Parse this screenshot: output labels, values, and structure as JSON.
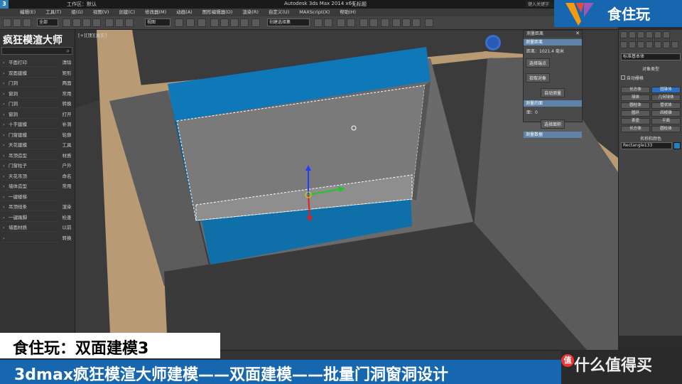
{
  "window": {
    "title": "Autodesk 3ds Max 2014 x64",
    "workspace": "工作区：默认",
    "status": "无标题",
    "search_placeholder": "键入关键字"
  },
  "menubar": {
    "items": [
      "编辑(E)",
      "工具(T)",
      "组(G)",
      "视图(V)",
      "创建(C)",
      "修改器(M)",
      "动画(A)",
      "图形编辑器(D)",
      "渲染(R)",
      "自定义(U)",
      "MAXScript(X)",
      "帮助(H)"
    ]
  },
  "toolbar": {
    "selection_filter": "全部",
    "view_mode": "视图",
    "named_selection": "创建选择集"
  },
  "left_panel": {
    "title": "疯狂模渲大师",
    "rows": [
      {
        "label": "平面打印",
        "side": "清除"
      },
      {
        "label": "双面建模",
        "side": "矩形"
      },
      {
        "label": "门洞",
        "side": "两面"
      },
      {
        "label": "窗洞",
        "side": "常用"
      },
      {
        "label": "门洞",
        "side": "转换"
      },
      {
        "label": "窗洞",
        "side": "打开"
      },
      {
        "label": "十字建模",
        "side": "补洞"
      },
      {
        "label": "门窗建模",
        "side": "轮廓"
      },
      {
        "label": "天花建模",
        "side": "工具"
      },
      {
        "label": "吊顶造型",
        "side": "材质"
      },
      {
        "label": "门窗柱子",
        "side": "户外"
      },
      {
        "label": "天花吊顶",
        "side": "命名"
      },
      {
        "label": "墙体造型",
        "side": "常用"
      },
      {
        "label": "一键楼梯",
        "side": ""
      },
      {
        "label": "吊顶线条",
        "side": "渲染"
      },
      {
        "label": "一键踢脚",
        "side": "检查"
      },
      {
        "label": "墙面材质",
        "side": "以前"
      },
      {
        "label": "",
        "side": "转换"
      }
    ]
  },
  "viewport": {
    "label": "[+][顶][真实]"
  },
  "float_panel": {
    "title": "测量距离",
    "section1": "测量距离",
    "distance": "距离：1021.4 毫米",
    "btn_a": "选择端点",
    "btn_b": "拾取对象",
    "btn_c": "自动测量",
    "section2": "测量的面",
    "faces": "面：0",
    "btn_d": "选择面积",
    "section3": "测量数据"
  },
  "right_panel": {
    "dropdown": "标准基本体",
    "group_title": "对象类型",
    "autogrid": "自动栅格",
    "grid_items": [
      "长方体",
      "圆锥体",
      "球体",
      "几何球体",
      "圆柱体",
      "管状体",
      "圆环",
      "四棱锥",
      "茶壶",
      "平面",
      "长方体",
      "圆柱体"
    ],
    "name_label": "名称和颜色",
    "name_value": "Rectangle133"
  },
  "brand": {
    "name": "食住玩"
  },
  "captions": {
    "line1": "食住玩：双面建模3",
    "line2": "3dmax疯狂模渲大师建模——双面建模——批量门洞窗洞设计"
  },
  "watermark": {
    "badge": "值",
    "text": "什么值得买"
  },
  "colors": {
    "wall_blue": "#0e78b8",
    "wood": "#b89a74",
    "brand_blue": "#1766b0"
  }
}
